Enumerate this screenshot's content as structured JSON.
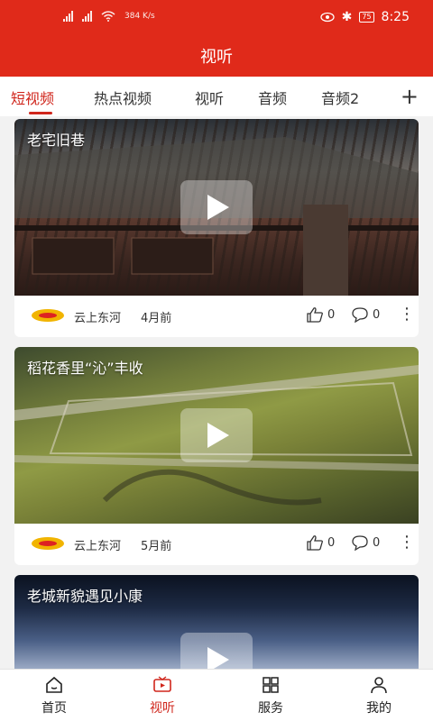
{
  "status_bar": {
    "network_speed": "384 K/s",
    "battery": "75",
    "time": "8:25"
  },
  "app": {
    "title": "视听"
  },
  "tabs": [
    {
      "label": "短视频",
      "active": true
    },
    {
      "label": "热点视频"
    },
    {
      "label": "视听"
    },
    {
      "label": "音频"
    },
    {
      "label": "音频2"
    }
  ],
  "add_tab_icon": "plus-icon",
  "videos": [
    {
      "title": "老宅旧巷",
      "source": "云上东河",
      "time": "4月前",
      "likes": "0",
      "comments": "0"
    },
    {
      "title": "稻花香里“沁”丰收",
      "source": "云上东河",
      "time": "5月前",
      "likes": "0",
      "comments": "0"
    },
    {
      "title": "老城新貌遇见小康"
    }
  ],
  "bottom_nav": [
    {
      "label": "首页",
      "icon": "home-icon"
    },
    {
      "label": "视听",
      "icon": "tv-icon",
      "active": true
    },
    {
      "label": "服务",
      "icon": "grid-icon"
    },
    {
      "label": "我的",
      "icon": "user-icon"
    }
  ],
  "colors": {
    "brand_red": "#e02a1a",
    "active_tab": "#d0261c"
  }
}
